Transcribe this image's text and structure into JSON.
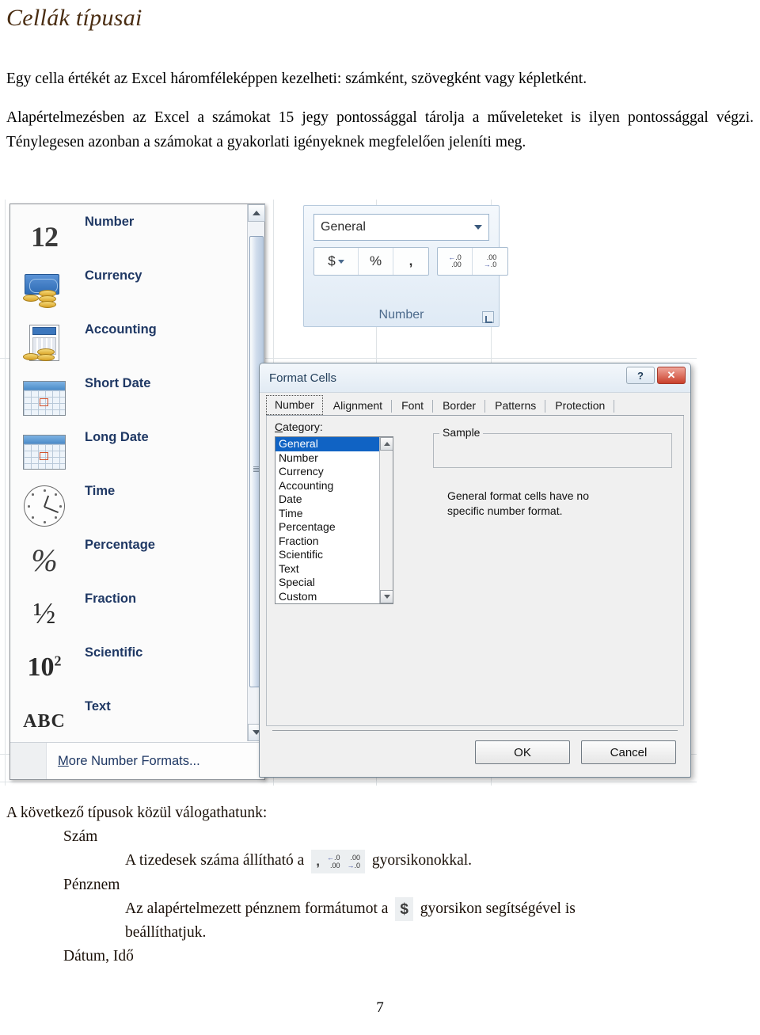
{
  "document": {
    "title": "Cellák típusai",
    "paragraph1": "Egy cella értékét az Excel háromféleképpen kezelheti: számként, szövegként vagy képletként.",
    "paragraph2": "Alapértelmezésben az Excel a számokat 15 jegy pontossággal tárolja a műveleteket is ilyen pontossággal végzi. Ténylegesen azonban a számokat a gyakorlati igényeknek megfelelően jeleníti meg.",
    "page_number": "7",
    "title_color": "#4a2d12"
  },
  "bottom_text": {
    "intro": "A következő típusok közül válogathatunk:",
    "item_number": "Szám",
    "decimals_before": "A tizedesek száma állítható a",
    "decimals_after": "gyorsikonokkal.",
    "item_currency": "Pénznem",
    "currency_before": "Az alapértelmezett pénznem formátumot a",
    "currency_after": "gyorsikon segítségével is",
    "currency_after2": "beállíthatjuk.",
    "item_date_time": "Dátum, Idő"
  },
  "gallery": {
    "items": [
      {
        "label": "Number",
        "icon": "number-12-icon"
      },
      {
        "label": "Currency",
        "icon": "currency-money-icon"
      },
      {
        "label": "Accounting",
        "icon": "accounting-calculator-icon"
      },
      {
        "label": "Short Date",
        "icon": "short-date-calendar-icon"
      },
      {
        "label": "Long Date",
        "icon": "long-date-calendar-icon"
      },
      {
        "label": "Time",
        "icon": "clock-icon"
      },
      {
        "label": "Percentage",
        "icon": "percent-icon"
      },
      {
        "label": "Fraction",
        "icon": "fraction-half-icon"
      },
      {
        "label": "Scientific",
        "icon": "scientific-ten-squared-icon"
      },
      {
        "label": "Text",
        "icon": "text-abc-icon"
      }
    ],
    "footer_label_accel": "M",
    "footer_label_rest": "ore Number Formats...",
    "icon_glyphs": {
      "number": "12",
      "percentage": "%",
      "fraction": "½",
      "scientific_base": "10",
      "scientific_exp": "2",
      "text": "ABC"
    },
    "label_color": "#1f3864"
  },
  "ribbon": {
    "group_label": "Number",
    "number_format_value": "General",
    "buttons": [
      {
        "name": "currency-button",
        "glyph": "$"
      },
      {
        "name": "percent-style-button",
        "glyph": "%"
      },
      {
        "name": "comma-style-button",
        "glyph": ","
      }
    ],
    "increase_decimal": {
      "top": ".0",
      "bottom": ".00",
      "arrow": "←"
    },
    "decrease_decimal": {
      "top": ".00",
      "bottom": ".0",
      "arrow": "→"
    }
  },
  "format_cells_dialog": {
    "title": "Format Cells",
    "help_button": "?",
    "close_button": "✕",
    "tabs": [
      "Number",
      "Alignment",
      "Font",
      "Border",
      "Patterns",
      "Protection"
    ],
    "active_tab": "Number",
    "category_label_accel": "C",
    "category_label_rest": "ategory:",
    "categories": [
      "General",
      "Number",
      "Currency",
      "Accounting",
      "Date",
      "Time",
      "Percentage",
      "Fraction",
      "Scientific",
      "Text",
      "Special",
      "Custom"
    ],
    "selected_category": "General",
    "sample_caption": "Sample",
    "sample_value": "",
    "description_line1": "General format cells have no",
    "description_line2": "specific number format.",
    "ok_button": "OK",
    "cancel_button": "Cancel",
    "selection_color": "#1063c4"
  }
}
